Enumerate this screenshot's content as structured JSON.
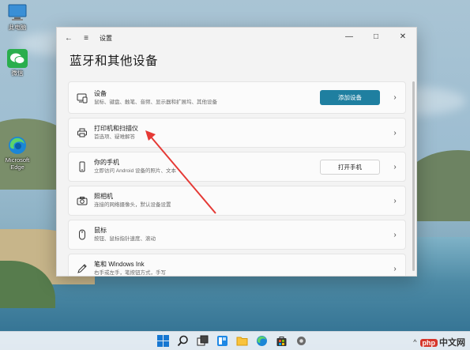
{
  "desktop": {
    "icons": [
      {
        "label": "此电脑",
        "icon": "computer-icon"
      },
      {
        "label": "微信",
        "icon": "wechat-icon"
      },
      {
        "label": "Microsoft Edge",
        "icon": "edge-icon"
      }
    ]
  },
  "window": {
    "title": "设置",
    "heading": "蓝牙和其他设备",
    "back_icon": "back-arrow-icon",
    "menu_icon": "hamburger-icon",
    "controls": {
      "minimize": "—",
      "maximize": "□",
      "close": "✕"
    }
  },
  "rows": [
    {
      "title": "设备",
      "subtitle": "鼠标、键盘、触笔、音频、显示器和扩展坞、其他设备",
      "icon": "devices-icon",
      "button": "添加设备",
      "button_style": "primary"
    },
    {
      "title": "打印机和扫描仪",
      "subtitle": "首选项、疑难解答",
      "icon": "printer-icon"
    },
    {
      "title": "你的手机",
      "subtitle": "立即访问 Android 设备的照片、文本",
      "icon": "phone-icon",
      "button": "打开手机",
      "button_style": "secondary"
    },
    {
      "title": "照相机",
      "subtitle": "连接的网络摄像头，默认设备设置",
      "icon": "camera-icon"
    },
    {
      "title": "鼠标",
      "subtitle": "按钮、鼠标指针速度、滚动",
      "icon": "mouse-icon"
    },
    {
      "title": "笔和 Windows Ink",
      "subtitle": "右手或左手，笔按钮方式，手写",
      "icon": "pen-icon"
    }
  ],
  "annotation": {
    "color": "#e53935"
  },
  "taskbar": {
    "icons": [
      "start-icon",
      "search-icon",
      "task-view-icon",
      "widgets-icon",
      "file-explorer-icon",
      "edge-icon",
      "store-icon",
      "settings-icon"
    ],
    "tray_caret": "^",
    "watermark": {
      "badge": "php",
      "text": "中文网"
    }
  },
  "colors": {
    "accent": "#1f7fa0"
  }
}
